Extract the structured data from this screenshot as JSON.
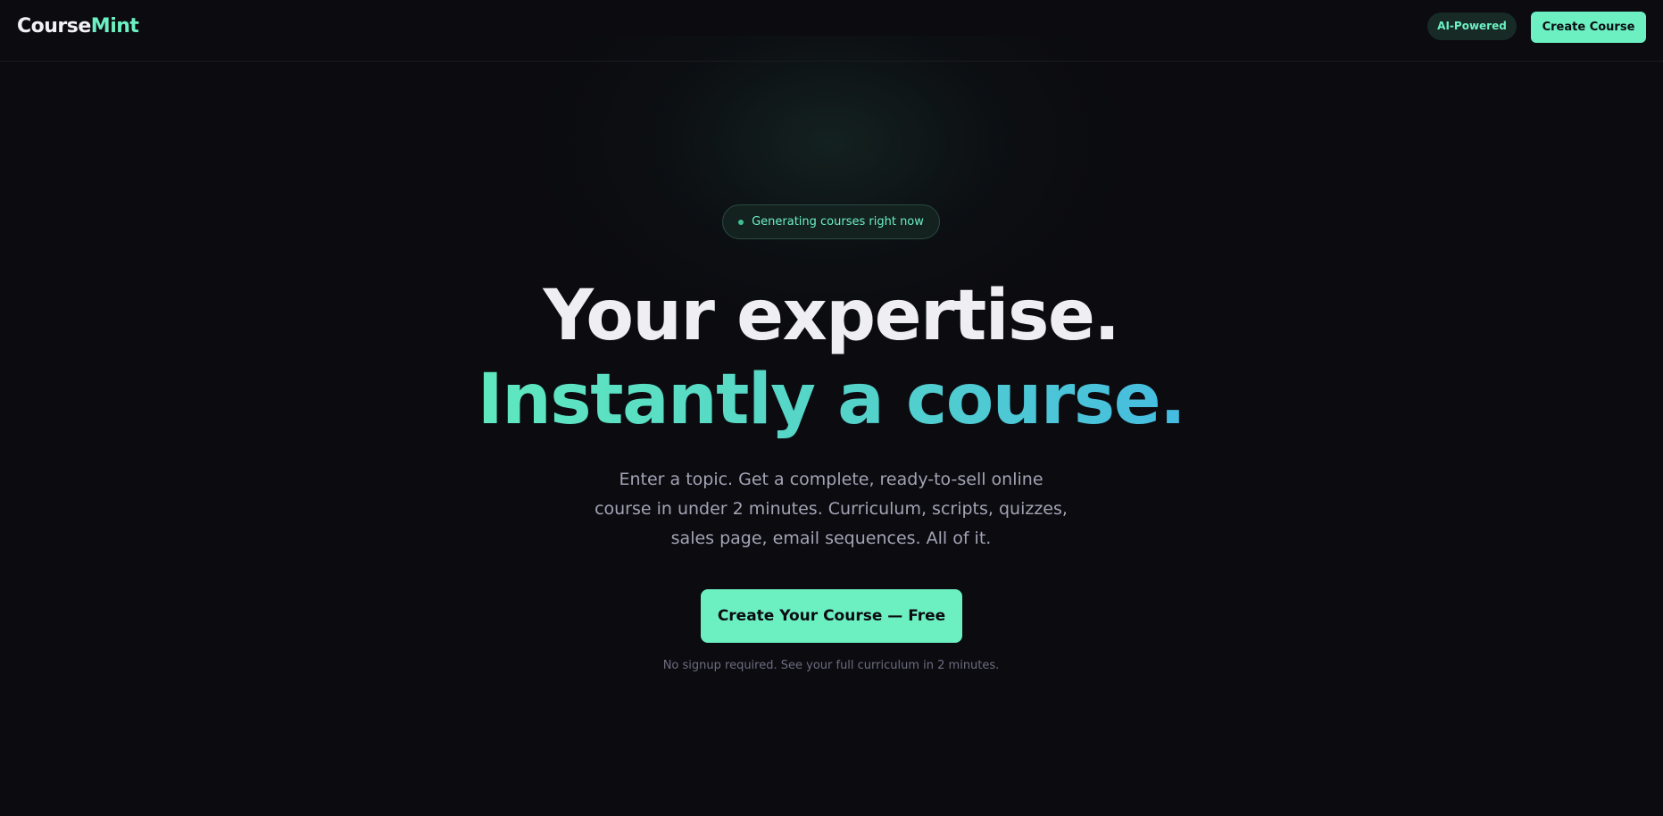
{
  "header": {
    "logo_part1": "Course",
    "logo_part2": "Mint",
    "badge": "AI-Powered",
    "create_button": "Create Course"
  },
  "hero": {
    "status_pill": "Generating courses right now",
    "headline_line1": "Your expertise.",
    "headline_line2": "Instantly a course.",
    "subtext": "Enter a topic. Get a complete, ready-to-sell online course in under 2 minutes. Curriculum, scripts, quizzes, sales page, email sequences. All of it.",
    "cta_button": "Create Your Course — Free",
    "note": "No signup required. See your full curriculum in 2 minutes."
  },
  "colors": {
    "background": "#0b0b10",
    "accent": "#6cf0c2",
    "gradient_start": "#5fe8bf",
    "gradient_end": "#45bce0",
    "headline": "#efeff3",
    "subtext": "#a3a3b4"
  }
}
